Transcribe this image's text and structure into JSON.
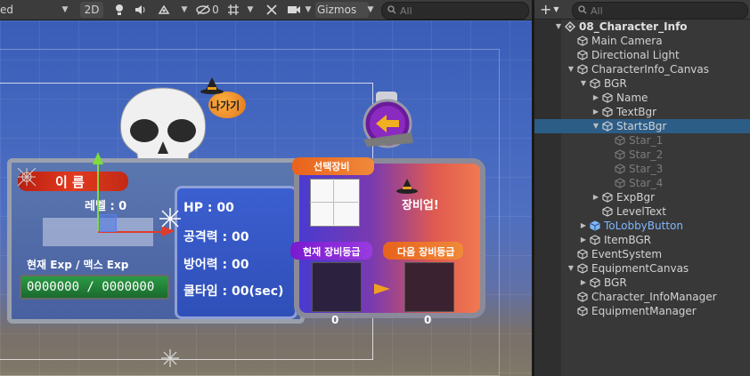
{
  "scene_toolbar": {
    "view_mode_label": "ed",
    "mode_2d_label": "2D",
    "hidden_count": "0",
    "gizmos_label": "Gizmos",
    "search_placeholder": "All"
  },
  "hierarchy": {
    "search_placeholder": "All",
    "items": [
      {
        "label": "08_Character_Info",
        "depth": 0,
        "arrow": "▼",
        "kind": "scene"
      },
      {
        "label": "Main Camera",
        "depth": 1,
        "arrow": "",
        "kind": "normal"
      },
      {
        "label": "Directional Light",
        "depth": 1,
        "arrow": "",
        "kind": "normal"
      },
      {
        "label": "CharacterInfo_Canvas",
        "depth": 1,
        "arrow": "▼",
        "kind": "normal"
      },
      {
        "label": "BGR",
        "depth": 2,
        "arrow": "▼",
        "kind": "normal"
      },
      {
        "label": "Name",
        "depth": 3,
        "arrow": "▶",
        "kind": "normal"
      },
      {
        "label": "TextBgr",
        "depth": 3,
        "arrow": "▶",
        "kind": "normal"
      },
      {
        "label": "StartsBgr",
        "depth": 3,
        "arrow": "▼",
        "kind": "selected"
      },
      {
        "label": "Star_1",
        "depth": 4,
        "arrow": "",
        "kind": "disabled"
      },
      {
        "label": "Star_2",
        "depth": 4,
        "arrow": "",
        "kind": "disabled"
      },
      {
        "label": "Star_3",
        "depth": 4,
        "arrow": "",
        "kind": "disabled"
      },
      {
        "label": "Star_4",
        "depth": 4,
        "arrow": "",
        "kind": "disabled"
      },
      {
        "label": "ExpBgr",
        "depth": 3,
        "arrow": "▶",
        "kind": "normal"
      },
      {
        "label": "LevelText",
        "depth": 3,
        "arrow": "",
        "kind": "normal"
      },
      {
        "label": "ToLobbyButton",
        "depth": 2,
        "arrow": "▶",
        "kind": "prefab"
      },
      {
        "label": "ItemBGR",
        "depth": 2,
        "arrow": "▶",
        "kind": "normal"
      },
      {
        "label": "EventSystem",
        "depth": 1,
        "arrow": "",
        "kind": "normal"
      },
      {
        "label": "EquipmentCanvas",
        "depth": 1,
        "arrow": "▼",
        "kind": "normal"
      },
      {
        "label": "BGR",
        "depth": 2,
        "arrow": "▶",
        "kind": "normal"
      },
      {
        "label": "Character_InfoManager",
        "depth": 1,
        "arrow": "",
        "kind": "normal"
      },
      {
        "label": "EquipmentManager",
        "depth": 1,
        "arrow": "",
        "kind": "normal"
      }
    ]
  },
  "game_ui": {
    "exit_button_label": "나가기",
    "name_label": "이 름",
    "level_label": "레벨 : 0",
    "exp_label": "현재 Exp / 맥스 Exp",
    "exp_value": "0000000 / 0000000",
    "hp_label": "HP : 00",
    "attack_label": "공격력 : 00",
    "defense_label": "방어력 : 00",
    "cooldown_label": "쿨타임 : 00(sec)",
    "selected_equip_label": "선택장비",
    "upgrade_label": "장비업!",
    "current_grade_label": "현재 장비등급",
    "next_grade_label": "다음 장비등급",
    "current_grade_value": "0",
    "next_grade_value": "0"
  },
  "colors": {
    "hierarchy_bg": "#383838",
    "selection": "#2c5d87",
    "prefab_text": "#7fb7ff",
    "name_banner": "#e03c20",
    "orange_tag": "#f07a28",
    "purple_tag": "#8b2bd6",
    "exp_bar": "#1f8a3a",
    "exit_orb": "#7a1aa0"
  }
}
